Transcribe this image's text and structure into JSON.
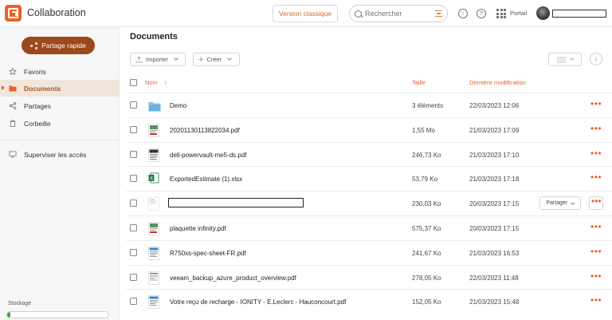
{
  "app": {
    "title": "Collaboration",
    "brand_color": "#e8622a"
  },
  "header": {
    "classic_label": "Version classique",
    "search_placeholder": "Rechercher",
    "portal_label": "Portail",
    "icons": [
      "refresh-icon",
      "help-icon",
      "apps-grid-icon",
      "filter-icon",
      "search-icon"
    ]
  },
  "sidebar": {
    "quick_share_label": "Partage rapide",
    "items": [
      {
        "label": "Favoris",
        "icon": "star-icon",
        "active": false
      },
      {
        "label": "Documents",
        "icon": "folder-icon",
        "active": true
      },
      {
        "label": "Partages",
        "icon": "share-icon",
        "active": false
      },
      {
        "label": "Corbeille",
        "icon": "trash-icon",
        "active": false
      },
      {
        "label": "Superviser les accès",
        "icon": "monitor-icon",
        "active": false
      }
    ],
    "storage_label": "Stockage",
    "storage_used_fraction": 0.03
  },
  "main": {
    "title": "Documents",
    "import_label": "Importer",
    "create_label": "Créer",
    "columns": {
      "name": "Nom",
      "size": "Taille",
      "modified": "Dernière modification"
    },
    "row_menu": "•••",
    "share_button_label": "Partager",
    "files": [
      {
        "name": "Demo",
        "size": "3 éléments",
        "date": "22/03/2023 12:06",
        "kind": "folder"
      },
      {
        "name": "20201130113822034.pdf",
        "size": "1,55 Mo",
        "date": "21/03/2023 17:09",
        "kind": "pdf-color"
      },
      {
        "name": "dell-powervault-me5-ds.pdf",
        "size": "246,73 Ko",
        "date": "21/03/2023 17:10",
        "kind": "pdf-dark"
      },
      {
        "name": "ExportedEstimate (1).xlsx",
        "size": "53,79 Ko",
        "date": "21/03/2023 17:18",
        "kind": "excel"
      },
      {
        "name": "",
        "size": "230,03 Ko",
        "date": "20/03/2023 17:15",
        "kind": "doc-light",
        "redacted": true
      },
      {
        "name": "plaquette infinity.pdf",
        "size": "575,37 Ko",
        "date": "20/03/2023 17:15",
        "kind": "pdf-color"
      },
      {
        "name": "R750xs-spec-sheet-FR.pdf",
        "size": "241,67 Ko",
        "date": "21/03/2023 16:53",
        "kind": "pdf-blue"
      },
      {
        "name": "veeam_backup_azure_product_overview.pdf",
        "size": "278,05 Ko",
        "date": "22/03/2023 11:48",
        "kind": "pdf-green"
      },
      {
        "name": "Votre reçu de recharge - IONITY - E.Leclerc - Hauconcourt.pdf",
        "size": "152,05 Ko",
        "date": "21/03/2023 15:48",
        "kind": "pdf-blue"
      }
    ]
  }
}
